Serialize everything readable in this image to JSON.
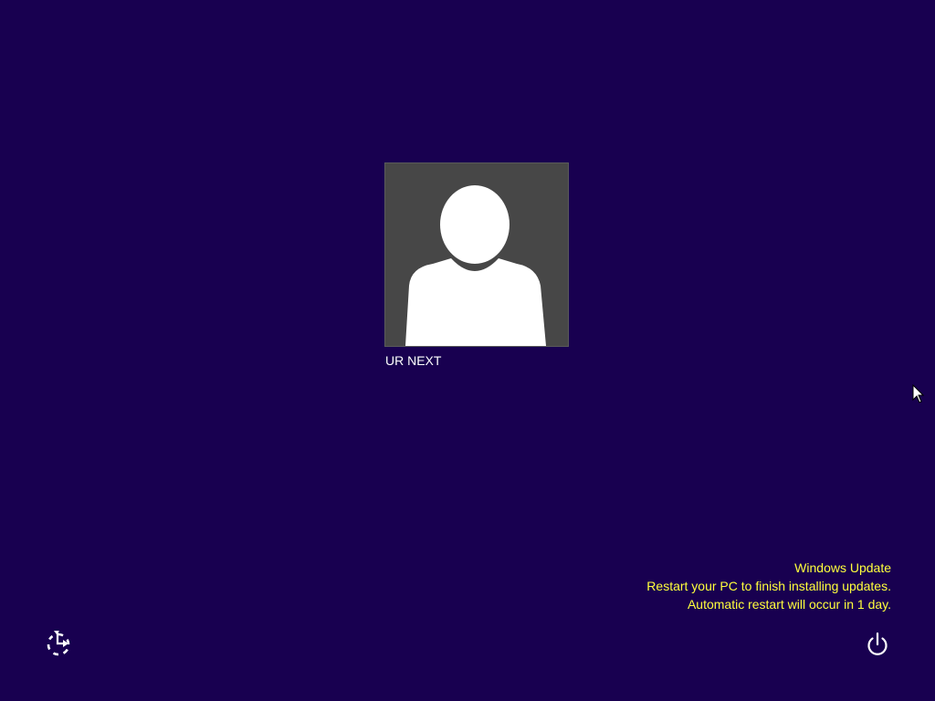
{
  "user": {
    "name": "UR NEXT",
    "avatar_icon": "default-user-silhouette-icon"
  },
  "update_notice": {
    "title": "Windows Update",
    "line1": "Restart your PC to finish installing updates.",
    "line2": "Automatic restart will occur in 1 day."
  },
  "controls": {
    "ease_of_access_icon": "ease-of-access-icon",
    "power_icon": "power-icon"
  },
  "colors": {
    "background": "#180050",
    "tile": "#474747",
    "notice_text": "#ffff3c",
    "text": "#ffffff"
  }
}
